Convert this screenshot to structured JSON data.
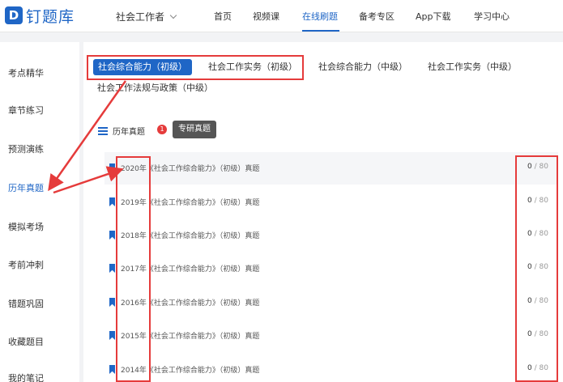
{
  "brand": {
    "logo_glyph": "D",
    "name": "钉题库"
  },
  "nav": {
    "exam_selector": "社会工作者",
    "items": [
      {
        "label": "首页",
        "active": false
      },
      {
        "label": "视频课",
        "active": false
      },
      {
        "label": "在线刷题",
        "active": true
      },
      {
        "label": "备考专区",
        "active": false
      },
      {
        "label": "App下载",
        "active": false
      },
      {
        "label": "学习中心",
        "active": false
      }
    ]
  },
  "sidebar": {
    "items": [
      {
        "label": "考点精华",
        "active": false
      },
      {
        "label": "章节练习",
        "active": false
      },
      {
        "label": "预测演练",
        "active": false
      },
      {
        "label": "历年真题",
        "active": true
      },
      {
        "label": "模拟考场",
        "active": false
      },
      {
        "label": "考前冲刺",
        "active": false
      },
      {
        "label": "错题巩固",
        "active": false
      },
      {
        "label": "收藏题目",
        "active": false
      },
      {
        "label": "我的笔记",
        "active": false
      }
    ]
  },
  "subject_tabs": [
    {
      "label": "社会综合能力（初级）",
      "active": true
    },
    {
      "label": "社会工作实务（初级）",
      "active": false
    },
    {
      "label": "社会综合能力（中级）",
      "active": false
    },
    {
      "label": "社会工作实务（中级）",
      "active": false
    },
    {
      "label": "社会工作法规与政策（中级）",
      "active": false
    }
  ],
  "section": {
    "title": "历年真题",
    "badge_count": "1",
    "tooltip": "专研真题"
  },
  "papers": [
    {
      "year": "2020年",
      "title": "《社会工作综合能力》（初级）真题",
      "done": "0",
      "total": "/ 80"
    },
    {
      "year": "2019年",
      "title": "《社会工作综合能力》（初级）真题",
      "done": "0",
      "total": "/ 80"
    },
    {
      "year": "2018年",
      "title": "《社会工作综合能力》（初级）真题",
      "done": "0",
      "total": "/ 80"
    },
    {
      "year": "2017年",
      "title": "《社会工作综合能力》（初级）真题",
      "done": "0",
      "total": "/ 80"
    },
    {
      "year": "2016年",
      "title": "《社会工作综合能力》（初级）真题",
      "done": "0",
      "total": "/ 80"
    },
    {
      "year": "2015年",
      "title": "《社会工作综合能力》（初级）真题",
      "done": "0",
      "total": "/ 80"
    },
    {
      "year": "2014年",
      "title": "《社会工作综合能力》（初级）真题",
      "done": "0",
      "total": "/ 80"
    }
  ],
  "colors": {
    "brand": "#1f66c6",
    "annotation": "#e53b3b",
    "tooltip": "#555555"
  },
  "icons": [
    "chevron-down-icon",
    "list-icon",
    "bookmark-icon"
  ]
}
